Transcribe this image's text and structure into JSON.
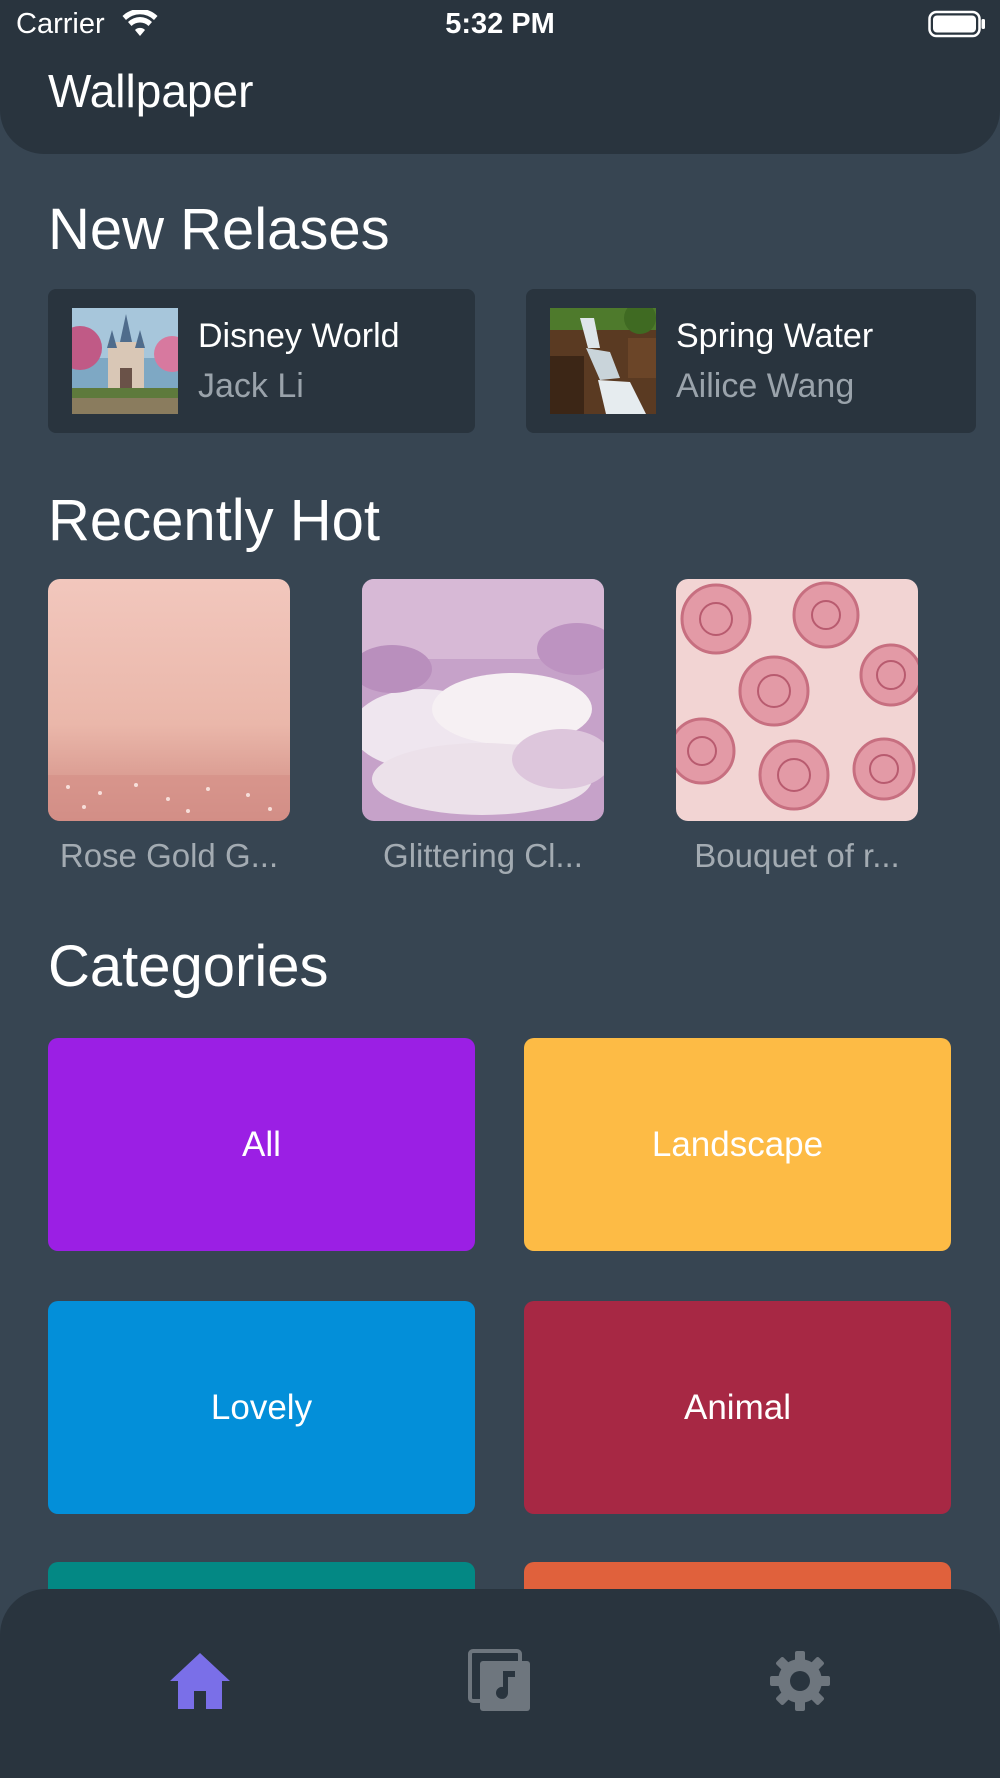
{
  "status_bar": {
    "carrier": "Carrier",
    "time": "5:32 PM"
  },
  "app_bar": {
    "title": "Wallpaper"
  },
  "new_releases": {
    "title": "New Relases",
    "items": [
      {
        "name": "Disney World",
        "author": "Jack Li"
      },
      {
        "name": "Spring Water",
        "author": "Ailice Wang"
      }
    ]
  },
  "recently_hot": {
    "title": "Recently Hot",
    "items": [
      {
        "caption": "Rose Gold G..."
      },
      {
        "caption": "Glittering Cl..."
      },
      {
        "caption": "Bouquet of r..."
      }
    ]
  },
  "categories": {
    "title": "Categories",
    "items": [
      {
        "label": "All",
        "color": "#9B1FE4"
      },
      {
        "label": "Landscape",
        "color": "#FDBB45"
      },
      {
        "label": "Lovely",
        "color": "#038FD9"
      },
      {
        "label": "Animal",
        "color": "#A72844"
      },
      {
        "label": "",
        "color": "#038884"
      },
      {
        "label": "",
        "color": "#E0613C"
      }
    ]
  },
  "bottom_nav": {
    "items": [
      {
        "icon": "home-icon",
        "active": true
      },
      {
        "icon": "music-library-icon",
        "active": false
      },
      {
        "icon": "gear-icon",
        "active": false
      }
    ],
    "active_color": "#7A6FE8",
    "inactive_color": "#6E767E"
  }
}
